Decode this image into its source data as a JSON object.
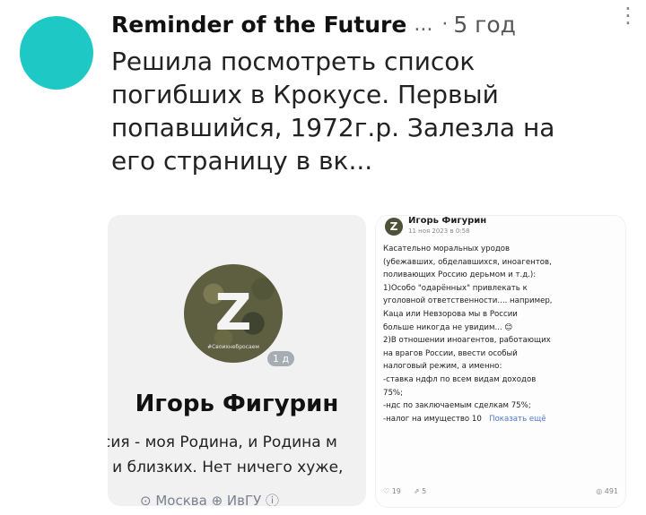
{
  "post": {
    "author": "Reminder of the Future",
    "ellipsis": "...",
    "dot": "·",
    "time": "5 год",
    "more_icon": "⋮",
    "text_lines": [
      "Решила посмотреть список",
      "погибших в Крокусе. Первый",
      "попавшийся, 1972г.р. Залезла на",
      "его страницу в вк..."
    ]
  },
  "profile": {
    "avatar_letter": "Z",
    "avatar_caption": "#Своихнебросаем",
    "age_badge": "1 д",
    "name": "Игорь Фигурин",
    "status_line1": "сия - моя Родина, и Родина м",
    "status_line2": ": и близких. Нет ничего хуже,",
    "location": "⊙ Москва  ⊕ ИвГУ  ⓘ"
  },
  "vk_post": {
    "avatar_letter": "Z",
    "name": "Игорь Фигурин",
    "date": "11 ноя 2023 в 0:58",
    "lines": [
      "Касательно моральных уродов",
      "(убежавших, обделавшихся, иноагентов,",
      "поливающих Россию дерьмом и т.д.):",
      "1)Особо \"одарённых\" привлекать к",
      "уголовной ответственности.... например,",
      "Каца или Невзорова мы в России",
      "больше никогда не увидим... 😊",
      "2)В отношении иноагентов, работающих",
      "на врагов России, ввести особый",
      "налоговый режим, а именно:",
      "-ставка ндфл по всем видам доходов",
      "75%;",
      "-ндс по заключаемым сделкам 75%;"
    ],
    "last_line": "-налог на имущество 10",
    "show_more": "Показать ещё",
    "likes": "♡ 19",
    "shares": "⇗ 5",
    "views": "◎ 491"
  }
}
